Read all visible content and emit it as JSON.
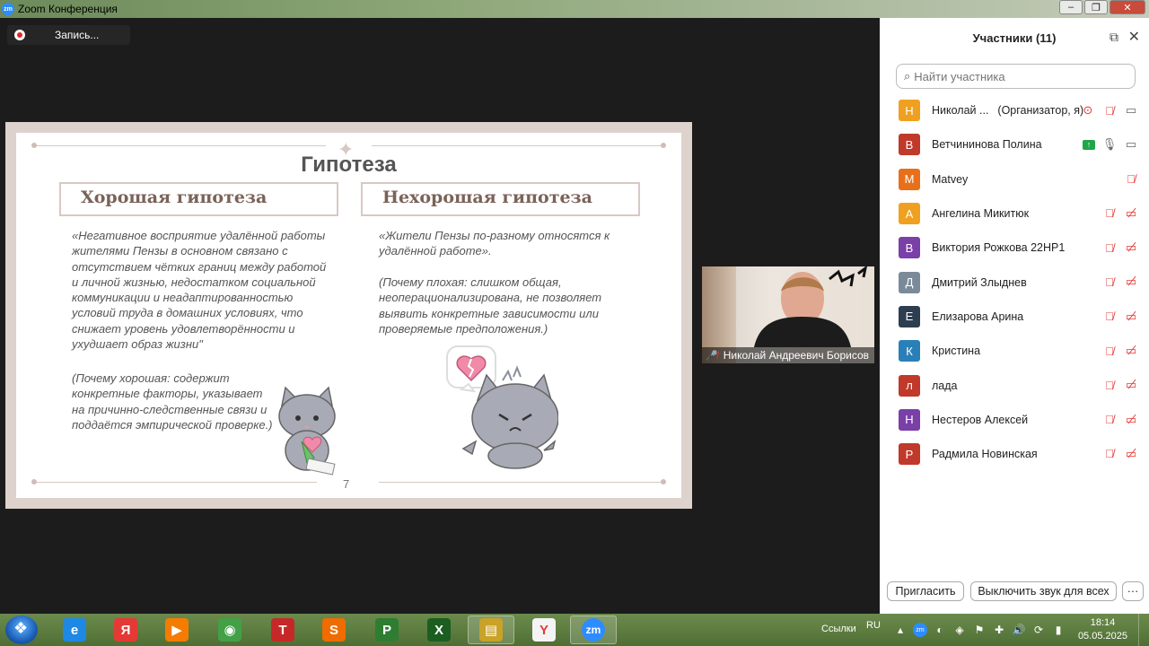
{
  "window": {
    "title": "Zoom Конференция",
    "app_icon": "zm"
  },
  "recording": {
    "label": "Запись..."
  },
  "slide": {
    "title": "Гипотеза",
    "left_heading": "Хорошая гипотеза",
    "right_heading": "Нехорошая гипотеза",
    "left_text": "«Негативное восприятие удалённой работы жителями Пензы в основном связано с отсутствием чётких границ между работой и личной жизнью, недостатком социальной коммуникации и неадаптированностью условий труда в домашних условиях, что снижает уровень удовлетворённости и ухудшает образ жизни\"",
    "left_note": "(Почему хорошая: содержит конкретные факторы, указывает на причинно-следственные связи и поддаётся эмпирической проверке.)",
    "right_text": "«Жители Пензы по-разному относятся к удалённой работе».",
    "right_note": "(Почему плохая: слишком общая, неоперационализирована, не позволяет выявить конкретные зависимости или проверяемые предположения.)",
    "page_number": "7"
  },
  "self_view": {
    "name": "Николай Андреевич Борисов"
  },
  "participants_panel": {
    "title": "Участники (11)",
    "search_placeholder": "Найти участника",
    "participants": [
      {
        "initial": "Н",
        "color": "#f0a020",
        "name": "Николай ...",
        "role": "(Организатор, я)",
        "icons": [
          "record-icon",
          "mic-muted-icon",
          "video-on-icon"
        ]
      },
      {
        "initial": "В",
        "color": "#c0392b",
        "name": "Ветчининова Полина",
        "role": "",
        "icons": [
          "share-screen-icon",
          "mic-on-icon",
          "video-on-icon"
        ]
      },
      {
        "initial": "M",
        "color": "#e8701a",
        "name": "Matvey",
        "role": "",
        "icons": [
          "mic-muted-icon"
        ]
      },
      {
        "initial": "А",
        "color": "#f0a020",
        "name": "Ангелина Микитюк",
        "role": "",
        "icons": [
          "mic-muted-icon",
          "video-off-icon"
        ]
      },
      {
        "initial": "В",
        "color": "#7b3fa8",
        "name": "Виктория Рожкова 22НР1",
        "role": "",
        "icons": [
          "mic-muted-icon",
          "video-off-icon"
        ]
      },
      {
        "initial": "Д",
        "color": "#7a8a99",
        "name": "Дмитрий Злыднев",
        "role": "",
        "icons": [
          "mic-muted-icon",
          "video-off-icon"
        ]
      },
      {
        "initial": "Е",
        "color": "#2c3e50",
        "name": "Елизарова Арина",
        "role": "",
        "icons": [
          "mic-muted-icon",
          "video-off-icon"
        ]
      },
      {
        "initial": "К",
        "color": "#2980b9",
        "name": "Кристина",
        "role": "",
        "icons": [
          "mic-muted-icon",
          "video-off-icon"
        ]
      },
      {
        "initial": "л",
        "color": "#c0392b",
        "name": "лада",
        "role": "",
        "icons": [
          "mic-muted-icon",
          "video-off-icon"
        ]
      },
      {
        "initial": "Н",
        "color": "#7b3fa8",
        "name": "Нестеров Алексей",
        "role": "",
        "icons": [
          "mic-muted-icon",
          "video-off-icon"
        ]
      },
      {
        "initial": "Р",
        "color": "#c0392b",
        "name": "Радмила Новинская",
        "role": "",
        "icons": [
          "mic-muted-icon",
          "video-off-icon"
        ]
      }
    ],
    "footer": {
      "invite": "Пригласить",
      "mute_all": "Выключить звук для всех",
      "more": "···"
    }
  },
  "taskbar": {
    "apps": [
      {
        "name": "ie",
        "glyph": "e",
        "color": "#1e88e5"
      },
      {
        "name": "yandex",
        "glyph": "Я",
        "color": "#e53935"
      },
      {
        "name": "media-player",
        "glyph": "▶",
        "color": "#f57c00"
      },
      {
        "name": "chrome",
        "glyph": "◉",
        "color": "#43a047"
      },
      {
        "name": "t-app",
        "glyph": "T",
        "color": "#c62828"
      },
      {
        "name": "s-app",
        "glyph": "S",
        "color": "#ef6c00"
      },
      {
        "name": "p-app",
        "glyph": "P",
        "color": "#2e7d32"
      },
      {
        "name": "excel",
        "glyph": "X",
        "color": "#1b5e20"
      },
      {
        "name": "explorer",
        "glyph": "▤",
        "color": "#c9a227"
      },
      {
        "name": "yandex-browser",
        "glyph": "Y",
        "color": "#f4f4f4"
      },
      {
        "name": "zoom",
        "glyph": "zm",
        "color": "#2d8cff"
      }
    ],
    "links_label": "Ссылки",
    "lang": "RU",
    "time": "18:14",
    "date": "05.05.2025"
  }
}
